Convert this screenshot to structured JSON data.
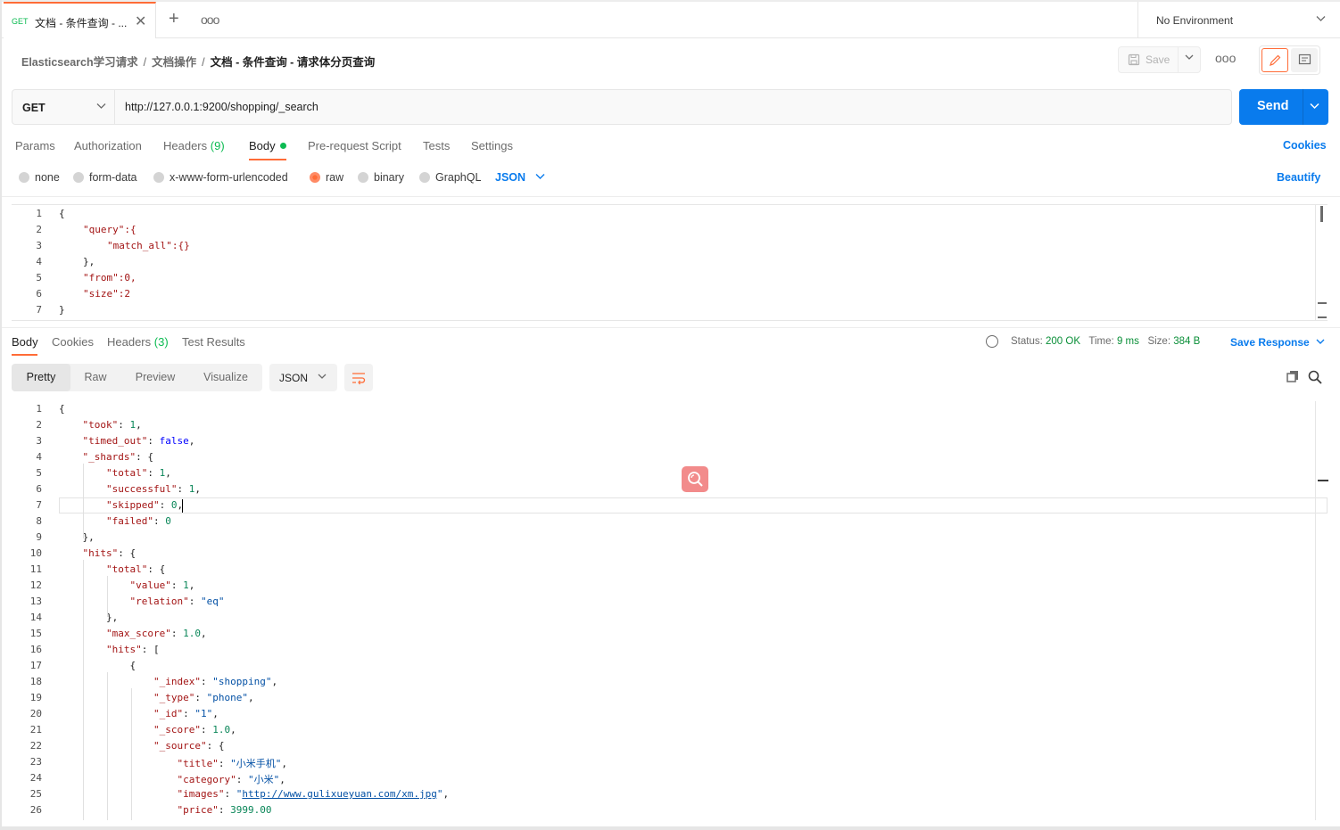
{
  "tab": {
    "method": "GET",
    "title": "文档 - 条件查询 - ..."
  },
  "environment": {
    "label": "No Environment"
  },
  "breadcrumb": [
    "Elasticsearch学习请求",
    "文档操作",
    "文档 - 条件查询 - 请求体分页查询"
  ],
  "toolbar": {
    "save_label": "Save"
  },
  "request": {
    "method": "GET",
    "url": "http://127.0.0.1:9200/shopping/_search",
    "send_label": "Send"
  },
  "request_tabs": {
    "params": "Params",
    "authorization": "Authorization",
    "headers": "Headers",
    "headers_count": "(9)",
    "body": "Body",
    "prerequest": "Pre-request Script",
    "tests": "Tests",
    "settings": "Settings",
    "cookies": "Cookies"
  },
  "body_types": {
    "none": "none",
    "form_data": "form-data",
    "urlencoded": "x-www-form-urlencoded",
    "raw": "raw",
    "binary": "binary",
    "graphql": "GraphQL",
    "format": "JSON",
    "beautify": "Beautify"
  },
  "request_body": {
    "lines": [
      "{",
      "\"query\":{",
      "\"match_all\":{}",
      "},",
      "\"from\":0,",
      "\"size\":2",
      "}"
    ]
  },
  "response_tabs": {
    "body": "Body",
    "cookies": "Cookies",
    "headers": "Headers",
    "headers_count": "(3)",
    "test_results": "Test Results"
  },
  "response_status": {
    "status_label": "Status:",
    "status": "200 OK",
    "time_label": "Time:",
    "time": "9 ms",
    "size_label": "Size:",
    "size": "384 B",
    "save_response": "Save Response"
  },
  "response_view": {
    "pretty": "Pretty",
    "raw": "Raw",
    "preview": "Preview",
    "visualize": "Visualize",
    "format": "JSON"
  },
  "response_body": {
    "lines": [
      "{",
      "\"took\": 1,",
      "\"timed_out\": false,",
      "\"_shards\": {",
      "\"total\": 1,",
      "\"successful\": 1,",
      "\"skipped\": 0,",
      "\"failed\": 0",
      "},",
      "\"hits\": {",
      "\"total\": {",
      "\"value\": 1,",
      "\"relation\": \"eq\"",
      "},",
      "\"max_score\": 1.0,",
      "\"hits\": [",
      "{",
      "\"_index\": \"shopping\",",
      "\"_type\": \"phone\",",
      "\"_id\": \"1\",",
      "\"_score\": 1.0,",
      "\"_source\": {",
      "\"title\": \"小米手机\",",
      "\"category\": \"小米\",",
      "\"images\": \"http://www.gulixueyuan.com/xm.jpg\",",
      "\"price\": 3999.00"
    ]
  },
  "colors": {
    "accent": "#ff6c37",
    "send": "#097bed",
    "success": "#0cbb52"
  }
}
